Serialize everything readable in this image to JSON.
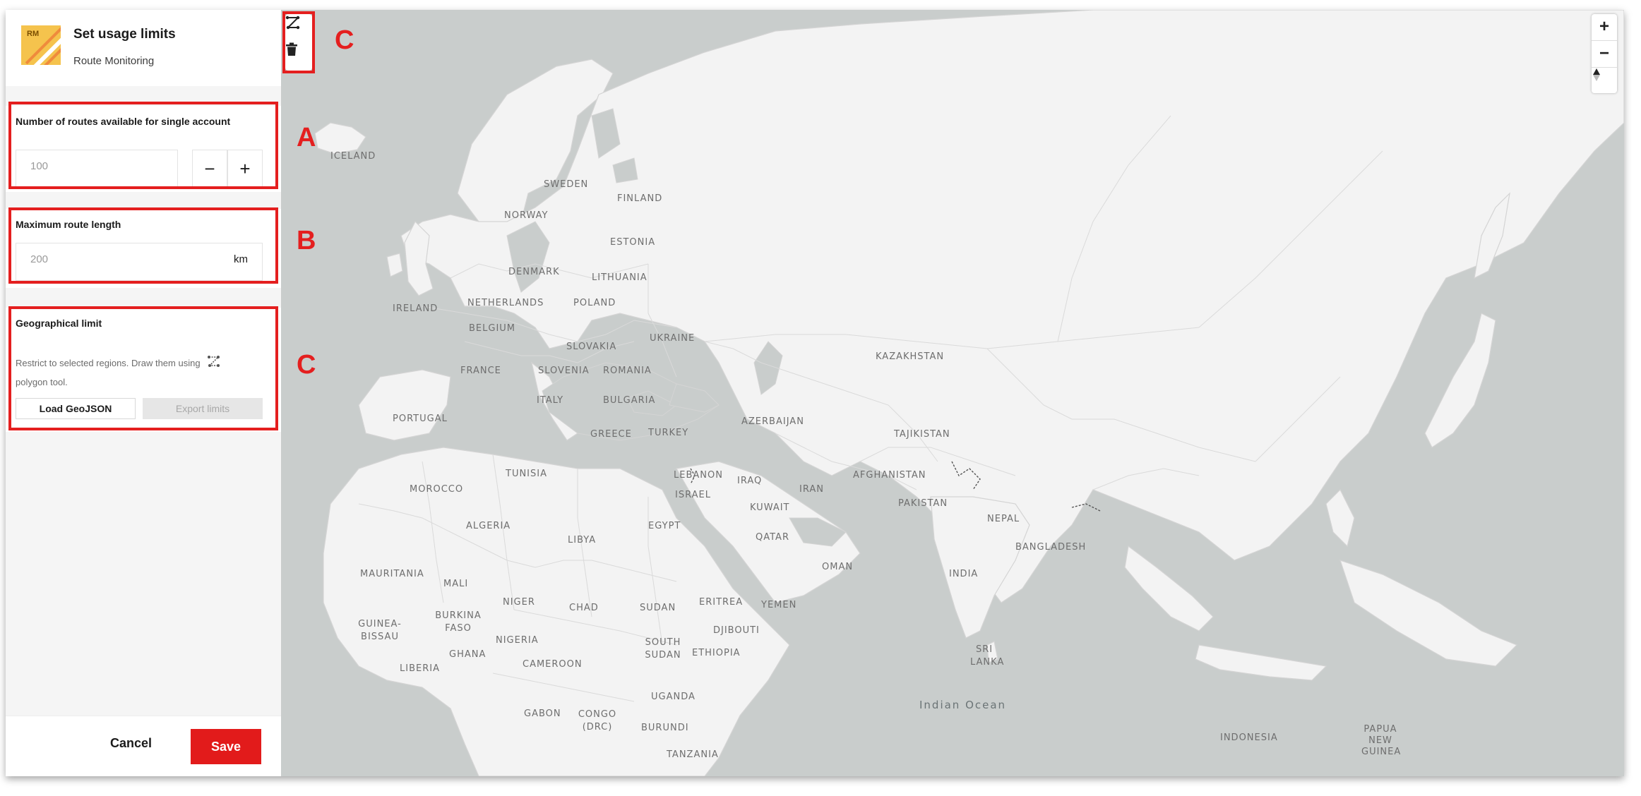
{
  "header": {
    "logo_text": "RM",
    "title": "Set usage limits",
    "subtitle": "Route Monitoring"
  },
  "routes_section": {
    "label": "Number of routes available for single account",
    "value": "100",
    "minus": "−",
    "plus": "+"
  },
  "length_section": {
    "label": "Maximum route length",
    "value": "200",
    "unit": "km"
  },
  "geo_section": {
    "label": "Geographical limit",
    "description_1": "Restrict to selected regions. Draw them using",
    "description_2": "polygon tool.",
    "load_button": "Load GeoJSON",
    "export_button": "Export limits"
  },
  "footer": {
    "cancel": "Cancel",
    "save": "Save"
  },
  "annotations": {
    "a": "A",
    "b": "B",
    "c_left": "C",
    "c_map": "C"
  },
  "map": {
    "zoom_in": "+",
    "zoom_out": "−",
    "labels": {
      "iceland": "ICELAND",
      "sweden": "SWEDEN",
      "finland": "FINLAND",
      "norway": "NORWAY",
      "estonia": "ESTONIA",
      "denmark": "DENMARK",
      "lithuania": "LITHUANIA",
      "ireland": "IRELAND",
      "netherlands": "NETHERLANDS",
      "poland": "POLAND",
      "belgium": "BELGIUM",
      "slovakia": "SLOVAKIA",
      "ukraine": "UKRAINE",
      "france": "FRANCE",
      "slovenia": "SLOVENIA",
      "romania": "ROMANIA",
      "italy": "ITALY",
      "bulgaria": "BULGARIA",
      "portugal": "PORTUGAL",
      "greece": "GREECE",
      "turkey": "TURKEY",
      "azerbaijan": "AZERBAIJAN",
      "kazakhstan": "KAZAKHSTAN",
      "tajikistan": "TAJIKISTAN",
      "tunisia": "TUNISIA",
      "lebanon": "LEBANON",
      "israel": "ISRAEL",
      "iraq": "IRAQ",
      "iran": "IRAN",
      "afghanistan": "AFGHANISTAN",
      "pakistan": "PAKISTAN",
      "morocco": "MOROCCO",
      "kuwait": "KUWAIT",
      "nepal": "NEPAL",
      "algeria": "ALGERIA",
      "libya": "LIBYA",
      "egypt": "EGYPT",
      "qatar": "QATAR",
      "bangladesh": "BANGLADESH",
      "oman": "OMAN",
      "india": "INDIA",
      "mauritania": "MAURITANIA",
      "mali": "MALI",
      "niger": "NIGER",
      "chad": "CHAD",
      "sudan": "SUDAN",
      "eritrea": "ERITREA",
      "yemen": "YEMEN",
      "burkina_faso": "BURKINA FASO",
      "guinea_bissau": "GUINEA-BISSAU",
      "djibouti": "DJIBOUTI",
      "nigeria": "NIGERIA",
      "ghana": "GHANA",
      "south_sudan": "SOUTH SUDAN",
      "ethiopia": "ETHIOPIA",
      "liberia": "LIBERIA",
      "cameroon": "CAMEROON",
      "sri_lanka": "SRI LANKA",
      "indian_ocean": "Indian Ocean",
      "uganda": "UGANDA",
      "gabon": "GABON",
      "congo_drc": "CONGO (DRC)",
      "burundi": "BURUNDI",
      "indonesia": "INDONESIA",
      "papua_new_guinea": "PAPUA NEW GUINEA",
      "tanzania": "TANZANIA"
    }
  },
  "colors": {
    "accent_red": "#e21b1b",
    "map_sea": "#c9cdcc",
    "map_land": "#f3f3f3"
  }
}
